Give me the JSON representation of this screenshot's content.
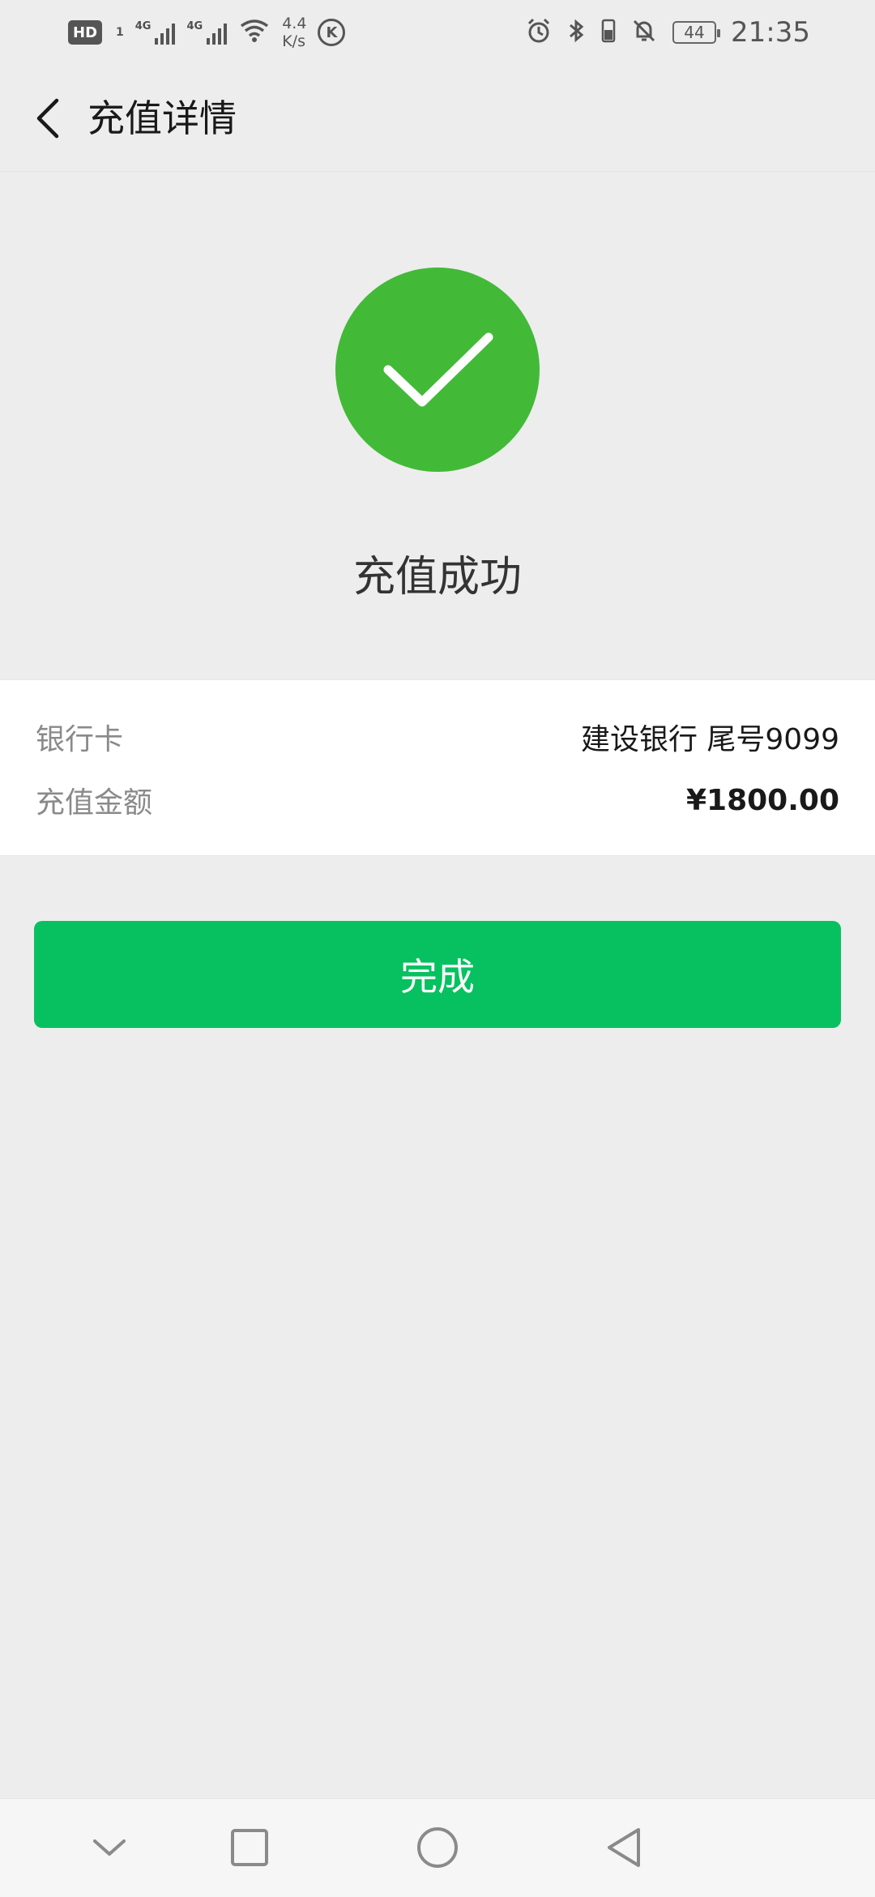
{
  "status_bar": {
    "hd_label": "HD",
    "hd_sub": "1",
    "net1": "4G",
    "net2": "4G",
    "speed_value": "4.4",
    "speed_unit": "K/s",
    "k_label": "K",
    "battery_level": "44",
    "time": "21:35"
  },
  "nav": {
    "title": "充值详情"
  },
  "result": {
    "status_text": "充值成功",
    "accent_color": "#43b938"
  },
  "details": {
    "rows": [
      {
        "label": "银行卡",
        "value": "建设银行 尾号9099"
      },
      {
        "label": "充值金额",
        "value": "¥1800.00"
      }
    ]
  },
  "actions": {
    "done_label": "完成",
    "button_color": "#07c160"
  },
  "system_nav": {
    "icons": [
      "chevron-down-icon",
      "square-icon",
      "circle-icon",
      "triangle-back-icon"
    ]
  }
}
